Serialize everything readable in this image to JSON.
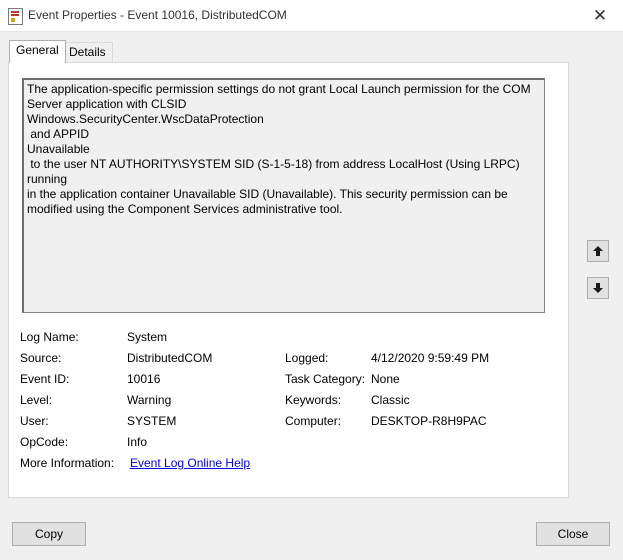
{
  "window": {
    "title": "Event Properties - Event 10016, DistributedCOM",
    "close_glyph": "✕"
  },
  "tabs": [
    {
      "label": "General",
      "active": true
    },
    {
      "label": "Details",
      "active": false
    }
  ],
  "description": "The application-specific permission settings do not grant Local Launch permission for the COM\nServer application with CLSID\nWindows.SecurityCenter.WscDataProtection\n and APPID\nUnavailable\n to the user NT AUTHORITY\\SYSTEM SID (S-1-5-18) from address LocalHost (Using LRPC) running\nin the application container Unavailable SID (Unavailable). This security permission can be\nmodified using the Component Services administrative tool.",
  "fields": {
    "log_name": {
      "label": "Log Name:",
      "value": "System"
    },
    "source": {
      "label": "Source:",
      "value": "DistributedCOM"
    },
    "event_id": {
      "label": "Event ID:",
      "value": "10016"
    },
    "level": {
      "label": "Level:",
      "value": "Warning"
    },
    "user": {
      "label": "User:",
      "value": "SYSTEM"
    },
    "opcode": {
      "label": "OpCode:",
      "value": "Info"
    },
    "more_info": {
      "label": "More Information:",
      "value": "Event Log Online Help"
    },
    "logged": {
      "label": "Logged:",
      "value": "4/12/2020 9:59:49 PM"
    },
    "task_category": {
      "label": "Task Category:",
      "value": "None"
    },
    "keywords": {
      "label": "Keywords:",
      "value": "Classic"
    },
    "computer": {
      "label": "Computer:",
      "value": "DESKTOP-R8H9PAC"
    }
  },
  "nav": {
    "up_icon": "arrow-up-icon",
    "down_icon": "arrow-down-icon"
  },
  "buttons": {
    "copy": "Copy",
    "close": "Close"
  },
  "colors": {
    "link": "#0000ee",
    "window_bg": "#f0f0f0"
  }
}
